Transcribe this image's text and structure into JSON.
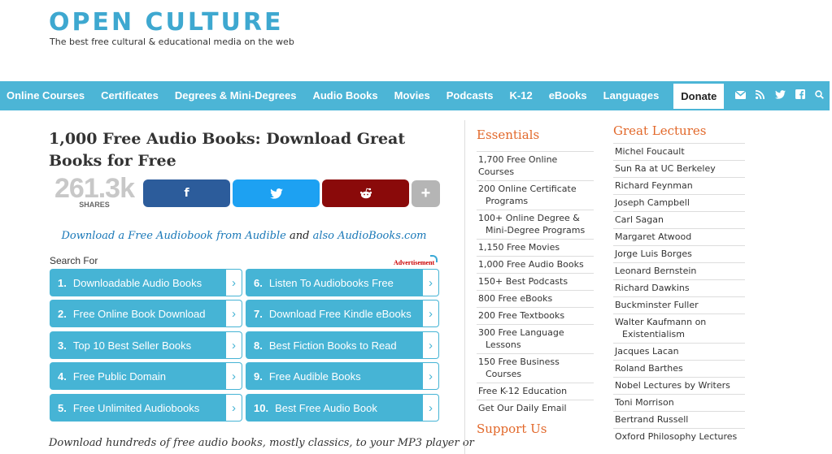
{
  "header": {
    "logo": "OPEN CULTURE",
    "tagline": "The best free cultural & educational media on the web"
  },
  "nav": {
    "items": [
      "Online Courses",
      "Certificates",
      "Degrees & Mini-Degrees",
      "Audio Books",
      "Movies",
      "Podcasts",
      "K-12",
      "eBooks",
      "Languages"
    ],
    "donate": "Donate",
    "icons": [
      "email-icon",
      "rss-icon",
      "twitter-icon",
      "facebook-icon",
      "search-icon"
    ]
  },
  "article": {
    "title": "1,000 Free Audio Books: Download Great Books for Free",
    "share_count": "261.3k",
    "share_label": "SHARES",
    "share_buttons": {
      "facebook": "f",
      "twitter": "🐦",
      "reddit": "👽",
      "more": "+"
    },
    "promo": {
      "link1": "Download a Free Audiobook from Audible",
      "and": " and ",
      "link2": "also AudioBooks.com"
    },
    "intro": "Download hundreds of free audio books, mostly classics, to your MP3 player or"
  },
  "ads": {
    "search_for": "Search For",
    "advertisement": "Advertisement",
    "items": [
      {
        "num": "1.",
        "label": "Downloadable Audio Books"
      },
      {
        "num": "6.",
        "label": "Listen To Audiobooks Free"
      },
      {
        "num": "2.",
        "label": "Free Online Book Download"
      },
      {
        "num": "7.",
        "label": "Download Free Kindle eBooks"
      },
      {
        "num": "3.",
        "label": "Top 10 Best Seller Books"
      },
      {
        "num": "8.",
        "label": "Best Fiction Books to Read"
      },
      {
        "num": "4.",
        "label": "Free Public Domain"
      },
      {
        "num": "9.",
        "label": "Free Audible Books"
      },
      {
        "num": "5.",
        "label": "Free Unlimited Audiobooks"
      },
      {
        "num": "10.",
        "label": "Best Free Audio Book"
      }
    ],
    "arrow": "›"
  },
  "essentials": {
    "heading": "Essentials",
    "items": [
      {
        "line1": "1,700 Free Online Courses",
        "line2": ""
      },
      {
        "line1": "200 Online Certificate",
        "line2": "Programs"
      },
      {
        "line1": "100+ Online Degree &",
        "line2": "Mini-Degree Programs"
      },
      {
        "line1": "1,150 Free Movies",
        "line2": ""
      },
      {
        "line1": "1,000 Free Audio Books",
        "line2": ""
      },
      {
        "line1": "150+ Best Podcasts",
        "line2": ""
      },
      {
        "line1": "800 Free eBooks",
        "line2": ""
      },
      {
        "line1": "200 Free Textbooks",
        "line2": ""
      },
      {
        "line1": "300 Free Language",
        "line2": "Lessons"
      },
      {
        "line1": "150 Free Business",
        "line2": "Courses"
      },
      {
        "line1": "Free K-12 Education",
        "line2": ""
      },
      {
        "line1": "Get Our Daily Email",
        "line2": ""
      }
    ],
    "support_heading": "Support Us"
  },
  "lectures": {
    "heading": "Great Lectures",
    "items": [
      {
        "line1": "Michel Foucault",
        "line2": ""
      },
      {
        "line1": "Sun Ra at UC Berkeley",
        "line2": ""
      },
      {
        "line1": "Richard Feynman",
        "line2": ""
      },
      {
        "line1": "Joseph Campbell",
        "line2": ""
      },
      {
        "line1": "Carl Sagan",
        "line2": ""
      },
      {
        "line1": "Margaret Atwood",
        "line2": ""
      },
      {
        "line1": "Jorge Luis Borges",
        "line2": ""
      },
      {
        "line1": "Leonard Bernstein",
        "line2": ""
      },
      {
        "line1": "Richard Dawkins",
        "line2": ""
      },
      {
        "line1": "Buckminster Fuller",
        "line2": ""
      },
      {
        "line1": "Walter Kaufmann on",
        "line2": "Existentialism"
      },
      {
        "line1": "Jacques Lacan",
        "line2": ""
      },
      {
        "line1": "Roland Barthes",
        "line2": ""
      },
      {
        "line1": "Nobel Lectures by Writers",
        "line2": ""
      },
      {
        "line1": "Toni Morrison",
        "line2": ""
      },
      {
        "line1": "Bertrand Russell",
        "line2": ""
      },
      {
        "line1": "Oxford Philosophy Lectures",
        "line2": ""
      }
    ]
  },
  "colors": {
    "brand": "#3ea8d0",
    "nav_bg": "#4cb5d6",
    "accent_orange": "#e2682a",
    "facebook": "#2c5c9b",
    "twitter": "#1da1f2",
    "reddit": "#8a0a0a"
  }
}
